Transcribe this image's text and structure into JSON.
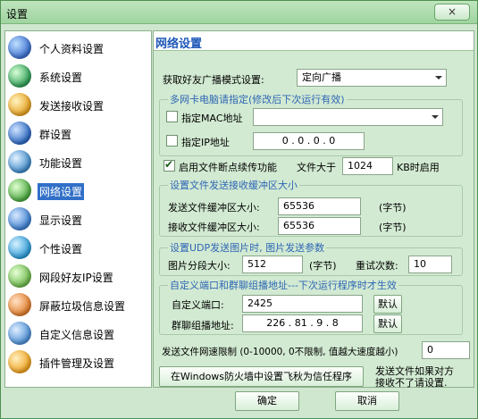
{
  "window": {
    "title": "设置",
    "close_label": "×"
  },
  "sidebar": {
    "items": [
      {
        "label": "个人资料设置",
        "icon": "user-profile-icon",
        "color": "#3b6fd0"
      },
      {
        "label": "系统设置",
        "icon": "system-gear-icon",
        "color": "#2e9e55"
      },
      {
        "label": "发送接收设置",
        "icon": "send-receive-icon",
        "color": "#e8a21f"
      },
      {
        "label": "群设置",
        "icon": "group-globe-icon",
        "color": "#2a68c2"
      },
      {
        "label": "功能设置",
        "icon": "function-icon",
        "color": "#3d89c9"
      },
      {
        "label": "网络设置",
        "icon": "network-icon",
        "color": "#4aa83e"
      },
      {
        "label": "显示设置",
        "icon": "display-icon",
        "color": "#3a7ed0"
      },
      {
        "label": "个性设置",
        "icon": "personal-icon",
        "color": "#2a9ad6"
      },
      {
        "label": "网段好友IP设置",
        "icon": "ip-segment-icon",
        "color": "#6cb84a"
      },
      {
        "label": "屏蔽垃圾信息设置",
        "icon": "block-spam-icon",
        "color": "#e27d2a"
      },
      {
        "label": "自定义信息设置",
        "icon": "custom-info-icon",
        "color": "#4b8fd6"
      },
      {
        "label": "插件管理及设置",
        "icon": "plugin-icon",
        "color": "#f0a31e"
      }
    ],
    "selected": "网络设置"
  },
  "panel": {
    "title": "网络设置",
    "broadcast_label": "获取好友广播模式设置:",
    "broadcast_value": "定向广播",
    "multi_nic_title": "多网卡电脑请指定(修改后下次运行有效)",
    "mac_label": "指定MAC地址",
    "mac_value": "",
    "ip_label": "指定IP地址",
    "ip_value": "0 . 0 . 0 . 0",
    "resume_label": "启用文件断点续传功能",
    "file_larger_label": "文件大于",
    "file_larger_value": "1024",
    "kb_enable_label": "KB时启用",
    "buffer_title": "设置文件发送接收缓冲区大小",
    "send_buffer_label": "发送文件缓冲区大小:",
    "send_buffer_value": "65536",
    "recv_buffer_label": "接收文件缓冲区大小:",
    "recv_buffer_value": "65536",
    "bytes_unit": "(字节)",
    "udp_title": "设置UDP发送图片时, 图片发送参数",
    "chunk_label": "图片分段大小:",
    "chunk_value": "512",
    "chunk_unit": "(字节)",
    "retry_label": "重试次数:",
    "retry_value": "10",
    "port_title": "自定义端口和群聊组播地址---下次运行程序时才生效",
    "port_label": "自定义端口:",
    "port_value": "2425",
    "multicast_label": "群聊组播地址:",
    "multicast_value": "226 . 81 . 9 . 8",
    "default_label": "默认",
    "speed_label": "发送文件网速限制 (0-10000, 0不限制, 值越大速度越小)",
    "speed_value": "0",
    "firewall_button": "在Windows防火墙中设置飞秋为信任程序",
    "firewall_note_line1": "发送文件如果对方",
    "firewall_note_line2": "接收不了请设置."
  },
  "footer": {
    "ok_label": "确定",
    "cancel_label": "取消"
  }
}
